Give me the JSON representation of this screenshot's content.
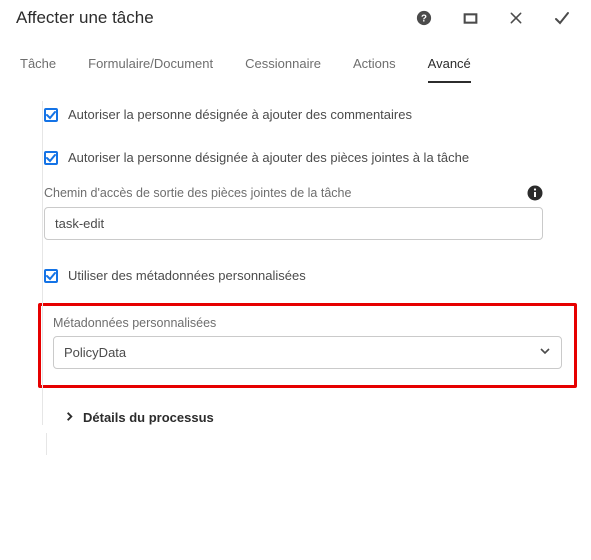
{
  "header": {
    "title": "Affecter une tâche"
  },
  "tabs": {
    "items": [
      {
        "label": "Tâche"
      },
      {
        "label": "Formulaire/Document"
      },
      {
        "label": "Cessionnaire"
      },
      {
        "label": "Actions"
      },
      {
        "label": "Avancé"
      }
    ],
    "activeIndex": 4
  },
  "form": {
    "allow_comments_label": "Autoriser la personne désignée à ajouter des commentaires",
    "allow_attachments_label": "Autoriser la personne désignée à ajouter des pièces jointes à la tâche",
    "output_path_label": "Chemin d'accès de sortie des pièces jointes de la tâche",
    "output_path_value": "task-edit",
    "use_custom_metadata_label": "Utiliser des métadonnées personnalisées",
    "custom_metadata_label": "Métadonnées personnalisées",
    "custom_metadata_value": "PolicyData",
    "process_details_label": "Détails du processus"
  }
}
